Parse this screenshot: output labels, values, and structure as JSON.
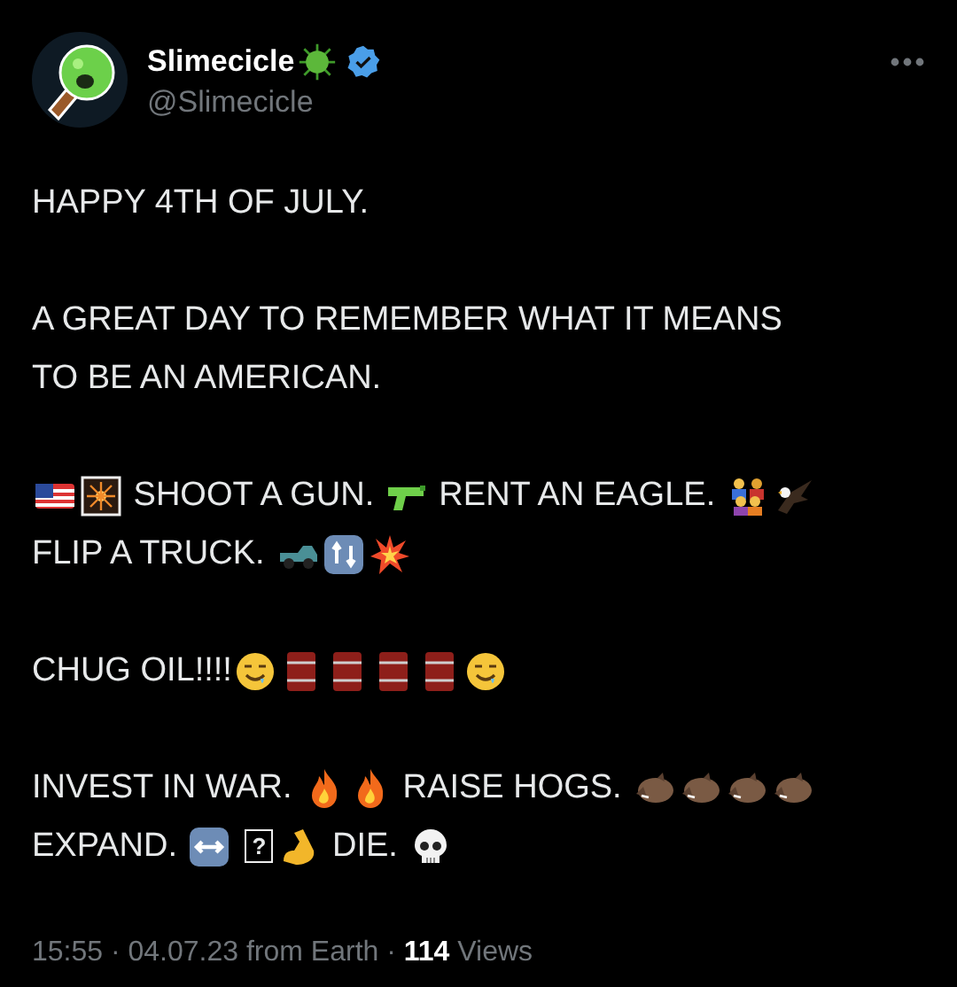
{
  "author": {
    "name": "Slimecicle",
    "handle": "@Slimecicle",
    "verified": true
  },
  "paragraphs": [
    [
      [
        {
          "kind": "text",
          "text": "HAPPY 4TH OF JULY."
        }
      ]
    ],
    [
      [
        {
          "kind": "text",
          "text": "A GREAT DAY TO REMEMBER WHAT IT MEANS"
        }
      ],
      [
        {
          "kind": "text",
          "text": "TO BE AN AMERICAN."
        }
      ]
    ],
    [
      [
        {
          "kind": "flag"
        },
        {
          "kind": "fireworks"
        },
        {
          "kind": "text",
          "text": " SHOOT A GUN. "
        },
        {
          "kind": "pistol"
        },
        {
          "kind": "text",
          "text": " RENT AN EAGLE. "
        },
        {
          "kind": "family"
        },
        {
          "kind": "eagle"
        }
      ],
      [
        {
          "kind": "text",
          "text": "FLIP A TRUCK. "
        },
        {
          "kind": "truck"
        },
        {
          "kind": "repeat"
        },
        {
          "kind": "collision"
        }
      ]
    ],
    [
      [
        {
          "kind": "text",
          "text": "CHUG OIL!!!!"
        },
        {
          "kind": "drool"
        },
        {
          "kind": "barrel"
        },
        {
          "kind": "barrel"
        },
        {
          "kind": "barrel"
        },
        {
          "kind": "barrel"
        },
        {
          "kind": "drool"
        }
      ]
    ],
    [
      [
        {
          "kind": "text",
          "text": "INVEST IN WAR. "
        },
        {
          "kind": "fire"
        },
        {
          "kind": "fire"
        },
        {
          "kind": "text",
          "text": " RAISE HOGS. "
        },
        {
          "kind": "boar"
        },
        {
          "kind": "boar"
        },
        {
          "kind": "boar"
        },
        {
          "kind": "boar"
        }
      ],
      [
        {
          "kind": "text",
          "text": "EXPAND. "
        },
        {
          "kind": "arrows"
        },
        {
          "kind": "missing",
          "text": "?"
        },
        {
          "kind": "muscle"
        },
        {
          "kind": "text",
          "text": " DIE. "
        },
        {
          "kind": "skull"
        }
      ]
    ]
  ],
  "footer": "15:55 · 04.07.23 from Earth · **114** Views"
}
